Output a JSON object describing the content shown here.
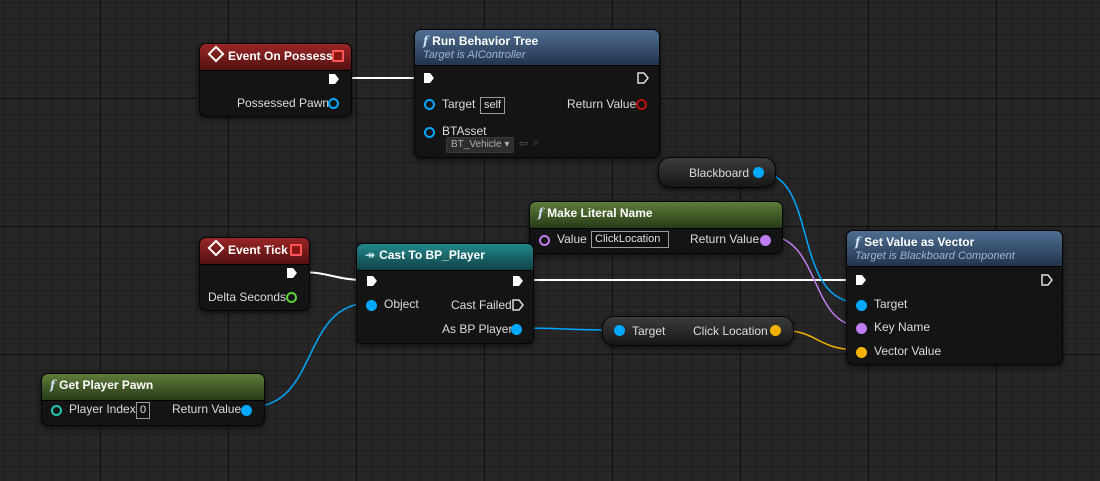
{
  "nodes": {
    "event_possess": {
      "title": "Event On Possess",
      "pin_possessed": "Possessed Pawn"
    },
    "run_bt": {
      "title": "Run Behavior Tree",
      "subtitle": "Target is AIController",
      "pin_target": "Target",
      "target_value": "self",
      "pin_return": "Return Value",
      "pin_btasset": "BTAsset",
      "btasset_value": "BT_Vehicle"
    },
    "blackboard": {
      "label": "Blackboard"
    },
    "make_literal": {
      "title": "Make Literal Name",
      "pin_value": "Value",
      "value": "ClickLocation",
      "pin_return": "Return Value"
    },
    "event_tick": {
      "title": "Event Tick",
      "pin_delta": "Delta Seconds"
    },
    "cast": {
      "title": "Cast To BP_Player",
      "pin_object": "Object",
      "pin_failed": "Cast Failed",
      "pin_as": "As BP Player"
    },
    "set_vector": {
      "title": "Set Value as Vector",
      "subtitle": "Target is Blackboard Component",
      "pin_target": "Target",
      "pin_key": "Key Name",
      "pin_vector": "Vector Value"
    },
    "click_loc": {
      "pin_target": "Target",
      "pin_out": "Click Location"
    },
    "get_pawn": {
      "title": "Get Player Pawn",
      "pin_index": "Player Index",
      "index_value": "0",
      "pin_return": "Return Value"
    }
  },
  "colors": {
    "exec": "#ffffff",
    "object": "#00a8ff",
    "name": "#c07df0",
    "vector": "#f2b300",
    "float": "#5fd23a",
    "int": "#1ec9b0"
  }
}
